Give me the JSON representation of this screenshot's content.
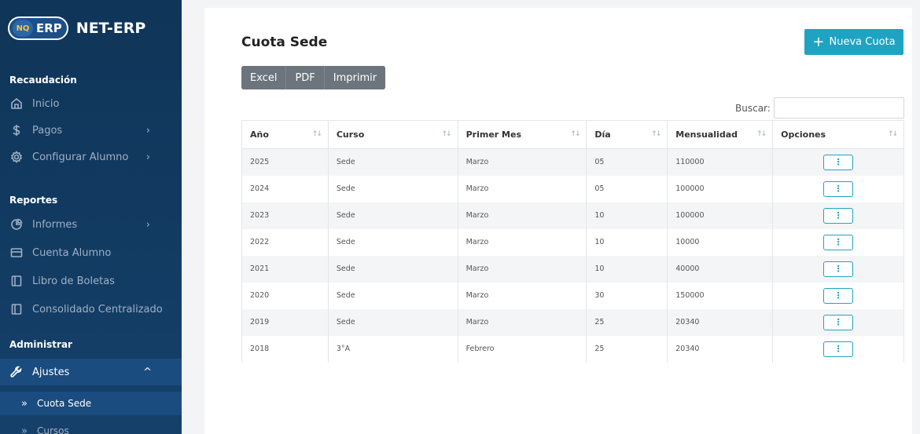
{
  "app": {
    "logo_mark": "NQ",
    "logo_text": "ERP",
    "name": "NET-ERP"
  },
  "sidebar": {
    "sections": [
      {
        "label": "Recaudación"
      },
      {
        "label": "Reportes"
      },
      {
        "label": "Administrar"
      }
    ],
    "items": [
      {
        "label": "Inicio",
        "icon": "home-icon"
      },
      {
        "label": "Pagos",
        "icon": "dollar-icon",
        "chevron": "›"
      },
      {
        "label": "Configurar Alumno",
        "icon": "gear-icon",
        "chevron": "›"
      },
      {
        "label": "Informes",
        "icon": "pie-chart-icon",
        "chevron": "›"
      },
      {
        "label": "Cuenta Alumno",
        "icon": "card-icon"
      },
      {
        "label": "Libro de Boletas",
        "icon": "book-icon"
      },
      {
        "label": "Consolidado Centralizado",
        "icon": "book-icon"
      },
      {
        "label": "Ajustes",
        "icon": "wrench-icon",
        "chevron": "^"
      }
    ],
    "subitems": [
      {
        "label": "Cuota Sede",
        "marker": "»"
      },
      {
        "label": "Cursos",
        "marker": "»"
      }
    ]
  },
  "page": {
    "title": "Cuota Sede",
    "new_button": "Nueva Cuota",
    "new_button_icon": "+",
    "exports": [
      "Excel",
      "PDF",
      "Imprimir"
    ],
    "search_label": "Buscar:",
    "search_value": ""
  },
  "table": {
    "columns": [
      "Año",
      "Curso",
      "Primer Mes",
      "Día",
      "Mensualidad",
      "Opciones"
    ],
    "sort_glyph": "↑↓",
    "options_glyph": "⋮",
    "rows": [
      [
        "2025",
        "Sede",
        "Marzo",
        "05",
        "110000"
      ],
      [
        "2024",
        "Sede",
        "Marzo",
        "05",
        "100000"
      ],
      [
        "2023",
        "Sede",
        "Marzo",
        "10",
        "100000"
      ],
      [
        "2022",
        "Sede",
        "Marzo",
        "10",
        "10000"
      ],
      [
        "2021",
        "Sede",
        "Marzo",
        "10",
        "40000"
      ],
      [
        "2020",
        "Sede",
        "Marzo",
        "30",
        "150000"
      ],
      [
        "2019",
        "Sede",
        "Marzo",
        "25",
        "20340"
      ],
      [
        "2018",
        "3°A",
        "Febrero",
        "25",
        "20340"
      ]
    ]
  },
  "colors": {
    "accent": "#1fa3c2",
    "sidebar": "#123a61",
    "export_buttons": "#6c757d"
  }
}
